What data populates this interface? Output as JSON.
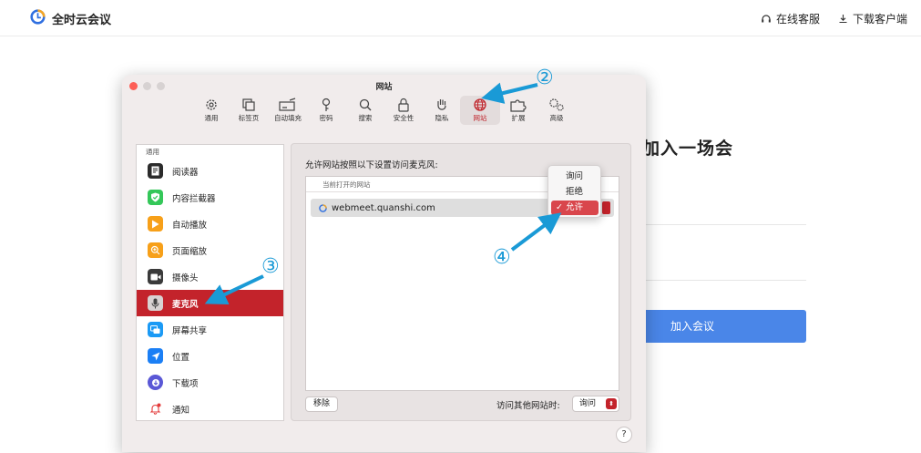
{
  "header": {
    "brand": "全时云会议",
    "support_label": "在线客服",
    "download_label": "下载客户端"
  },
  "page": {
    "join_title": "加入一场会",
    "join_button": "加入会议"
  },
  "window": {
    "title": "网站",
    "toolbar": [
      {
        "label": "通用",
        "icon": "gear-icon"
      },
      {
        "label": "标签页",
        "icon": "tabs-icon"
      },
      {
        "label": "自动填充",
        "icon": "autofill-icon"
      },
      {
        "label": "密码",
        "icon": "key-icon"
      },
      {
        "label": "搜索",
        "icon": "search-icon"
      },
      {
        "label": "安全性",
        "icon": "lock-icon"
      },
      {
        "label": "隐私",
        "icon": "hand-icon"
      },
      {
        "label": "网站",
        "icon": "globe-icon",
        "active": true
      },
      {
        "label": "扩展",
        "icon": "puzzle-icon"
      },
      {
        "label": "高级",
        "icon": "gears-icon"
      }
    ],
    "sidebar": {
      "header": "通用",
      "items": [
        {
          "label": "阅读器",
          "icon": "reader-icon"
        },
        {
          "label": "内容拦截器",
          "icon": "content-blocker-icon"
        },
        {
          "label": "自动播放",
          "icon": "autoplay-icon"
        },
        {
          "label": "页面缩放",
          "icon": "zoom-icon"
        },
        {
          "label": "摄像头",
          "icon": "camera-icon"
        },
        {
          "label": "麦克风",
          "icon": "microphone-icon",
          "selected": true
        },
        {
          "label": "屏幕共享",
          "icon": "screen-share-icon"
        },
        {
          "label": "位置",
          "icon": "location-icon"
        },
        {
          "label": "下载项",
          "icon": "downloads-icon"
        },
        {
          "label": "通知",
          "icon": "notifications-icon"
        }
      ]
    },
    "panel": {
      "label": "允许网站按照以下设置访问麦克风:",
      "list_header": "当前打开的网站",
      "site": "webmeet.quanshi.com",
      "remove_button": "移除",
      "other_sites_label": "访问其他网站时:",
      "other_sites_value": "询问",
      "help": "?"
    },
    "popup": {
      "options": [
        "询问",
        "拒绝",
        "允许"
      ],
      "selected": "允许",
      "checkmark": "✓"
    }
  },
  "annotations": {
    "n2": "②",
    "n3": "③",
    "n4": "④",
    "arrow_color": "#1a9ad6"
  }
}
